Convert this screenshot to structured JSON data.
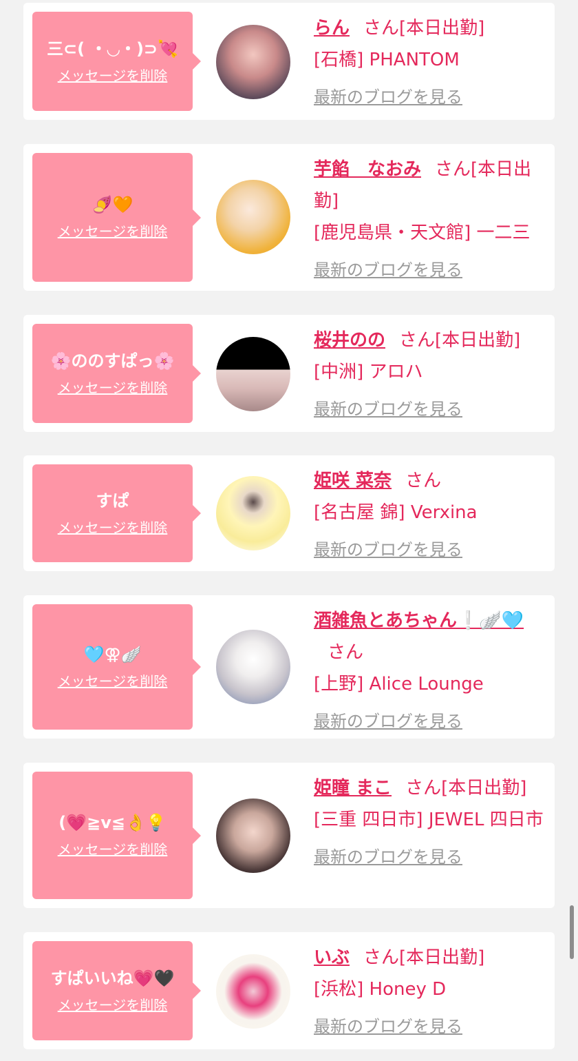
{
  "common": {
    "delete_label": "メッセージを削除",
    "san": "さん",
    "blog_label": "最新のブログを見る"
  },
  "cards": [
    {
      "message": "三⊂( ・◡・)⊃💘",
      "name": "らん",
      "status": "[本日出勤]",
      "shop": "[石橋] PHANTOM"
    },
    {
      "message": "🍠🧡",
      "name": "芋餡　なおみ",
      "status": "[本日出勤]",
      "shop": "[鹿児島県・天文館] 一二三"
    },
    {
      "message": "🌸ののすぱっ🌸",
      "name": "桜井のの",
      "status": "[本日出勤]",
      "shop": "[中洲] アロハ"
    },
    {
      "message": "すぱ",
      "name": "姫咲 菜奈",
      "status": "",
      "shop": "[名古屋 錦] Verxina"
    },
    {
      "message": "🩵⚢🪽",
      "name": "酒雑魚とあちゃん❕🪽🩵",
      "status": "",
      "shop": "[上野] Alice Lounge"
    },
    {
      "message": "(💗≧v≦👌💡",
      "name": "姫瞳 まこ",
      "status": "[本日出勤]",
      "shop": "[三重 四日市] JEWEL 四日市"
    },
    {
      "message": "すぱいいね💗🖤",
      "name": "いぶ",
      "status": "[本日出勤]",
      "shop": "[浜松] Honey D"
    }
  ],
  "colors": {
    "background": "#f2f2f2",
    "bubble": "#fe95a6",
    "accent": "#e4285b",
    "link_gray": "#9a9a9a"
  }
}
